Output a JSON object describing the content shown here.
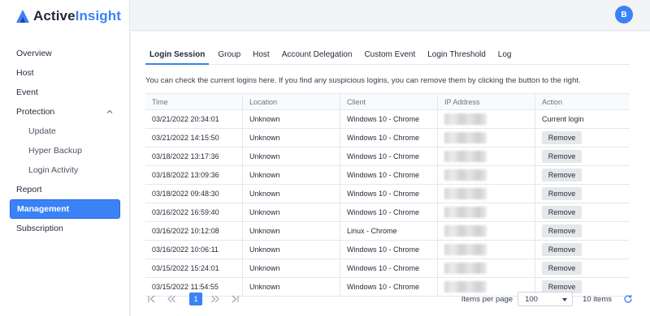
{
  "app": {
    "logo_text_primary": "Active",
    "logo_text_accent": "Insight",
    "brand_color": "#3b82f6"
  },
  "sidebar": {
    "items": [
      {
        "label": "Overview"
      },
      {
        "label": "Host"
      },
      {
        "label": "Event"
      },
      {
        "label": "Protection",
        "expanded": true
      },
      {
        "label": "Update"
      },
      {
        "label": "Hyper Backup"
      },
      {
        "label": "Login Activity"
      },
      {
        "label": "Report"
      },
      {
        "label": "Management",
        "active": true
      },
      {
        "label": "Subscription"
      }
    ]
  },
  "header": {
    "avatar_initial": "B"
  },
  "tabs": [
    {
      "label": "Login Session",
      "active": true
    },
    {
      "label": "Group"
    },
    {
      "label": "Host"
    },
    {
      "label": "Account Delegation"
    },
    {
      "label": "Custom Event"
    },
    {
      "label": "Login Threshold"
    },
    {
      "label": "Log"
    }
  ],
  "info_text": "You can check the current logins here. If you find any suspicious logins, you can remove them by clicking the button to the right.",
  "table": {
    "headers": {
      "time": "Time",
      "location": "Location",
      "client": "Client",
      "ip": "IP Address",
      "action": "Action"
    },
    "rows": [
      {
        "time": "03/21/2022 20:34:01",
        "location": "Unknown",
        "client": "Windows 10 - Chrome",
        "action": "Current login"
      },
      {
        "time": "03/21/2022 14:15:50",
        "location": "Unknown",
        "client": "Windows 10 - Chrome",
        "action": "Remove"
      },
      {
        "time": "03/18/2022 13:17:36",
        "location": "Unknown",
        "client": "Windows 10 - Chrome",
        "action": "Remove"
      },
      {
        "time": "03/18/2022 13:09:36",
        "location": "Unknown",
        "client": "Windows 10 - Chrome",
        "action": "Remove"
      },
      {
        "time": "03/18/2022 09:48:30",
        "location": "Unknown",
        "client": "Windows 10 - Chrome",
        "action": "Remove"
      },
      {
        "time": "03/16/2022 16:59:40",
        "location": "Unknown",
        "client": "Windows 10 - Chrome",
        "action": "Remove"
      },
      {
        "time": "03/16/2022 10:12:08",
        "location": "Unknown",
        "client": "Linux - Chrome",
        "action": "Remove"
      },
      {
        "time": "03/16/2022 10:06:11",
        "location": "Unknown",
        "client": "Windows 10 - Chrome",
        "action": "Remove"
      },
      {
        "time": "03/15/2022 15:24:01",
        "location": "Unknown",
        "client": "Windows 10 - Chrome",
        "action": "Remove"
      },
      {
        "time": "03/15/2022 11:54:55",
        "location": "Unknown",
        "client": "Windows 10 - Chrome",
        "action": "Remove"
      }
    ]
  },
  "pagination": {
    "current_page": "1",
    "items_per_page_label": "Items per page",
    "items_per_page_value": "100",
    "total_label": "10 items"
  }
}
